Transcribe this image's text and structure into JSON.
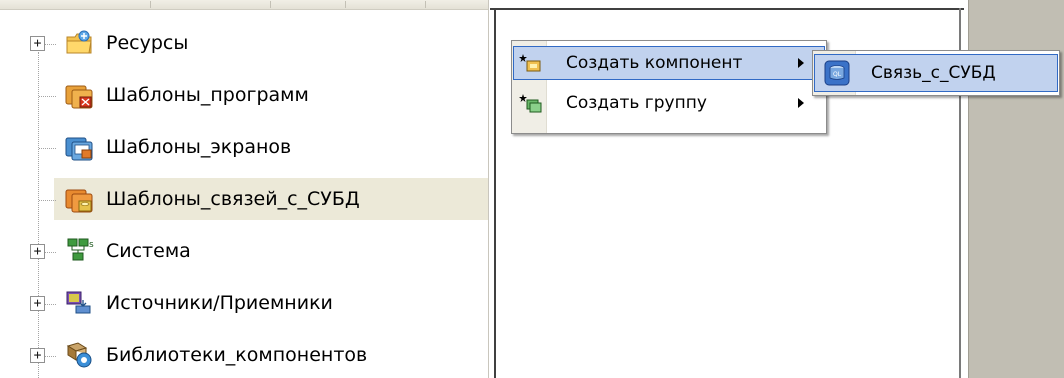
{
  "tree": {
    "items": [
      {
        "label": "Ресурсы",
        "expander": "+",
        "icon": "folder-resources-icon"
      },
      {
        "label": "Шаблоны_программ",
        "expander": "",
        "icon": "program-templates-icon"
      },
      {
        "label": "Шаблоны_экранов",
        "expander": "",
        "icon": "screen-templates-icon"
      },
      {
        "label": "Шаблоны_связей_с_СУБД",
        "expander": "",
        "icon": "dbms-templates-icon",
        "selected": true
      },
      {
        "label": "Система",
        "expander": "+",
        "icon": "system-network-icon"
      },
      {
        "label": "Источники/Приемники",
        "expander": "+",
        "icon": "sources-receivers-icon"
      },
      {
        "label": "Библиотеки_компонентов",
        "expander": "+",
        "icon": "component-library-icon"
      }
    ]
  },
  "context_menu": {
    "items": [
      {
        "label": "Создать компонент",
        "icon": "create-component-icon",
        "has_submenu": true,
        "highlighted": true
      },
      {
        "label": "Создать группу",
        "icon": "create-group-icon",
        "has_submenu": true,
        "highlighted": false
      }
    ]
  },
  "submenu": {
    "items": [
      {
        "label": "Связь_с_СУБД",
        "icon": "database-link-icon",
        "highlighted": true
      }
    ]
  },
  "colors": {
    "menu_highlight": "#c1d2ee",
    "menu_highlight_border": "#316ac5",
    "tree_selected": "#ece9d8",
    "side_panel": "#c1beb3"
  }
}
